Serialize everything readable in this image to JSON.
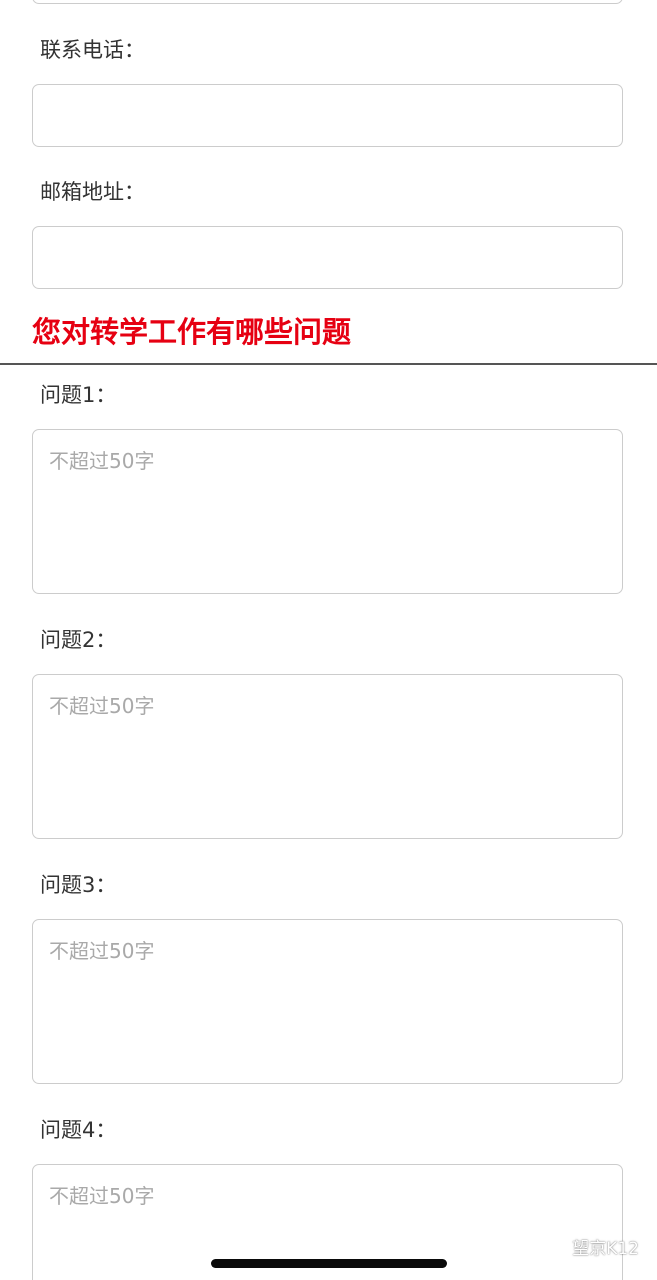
{
  "contact": {
    "phone_label": "联系电话：",
    "phone_value": "",
    "email_label": "邮箱地址：",
    "email_value": ""
  },
  "section": {
    "title": "您对转学工作有哪些问题"
  },
  "questions": [
    {
      "label": "问题1：",
      "placeholder": "不超过50字",
      "value": ""
    },
    {
      "label": "问题2：",
      "placeholder": "不超过50字",
      "value": ""
    },
    {
      "label": "问题3：",
      "placeholder": "不超过50字",
      "value": ""
    },
    {
      "label": "问题4：",
      "placeholder": "不超过50字",
      "value": ""
    }
  ],
  "watermark": {
    "text": "望京K12",
    "icon": "wechat-icon"
  },
  "colors": {
    "section_title": "#e60012",
    "field_border": "#cccccc",
    "placeholder": "#a9a9a9",
    "divider": "#555555"
  }
}
